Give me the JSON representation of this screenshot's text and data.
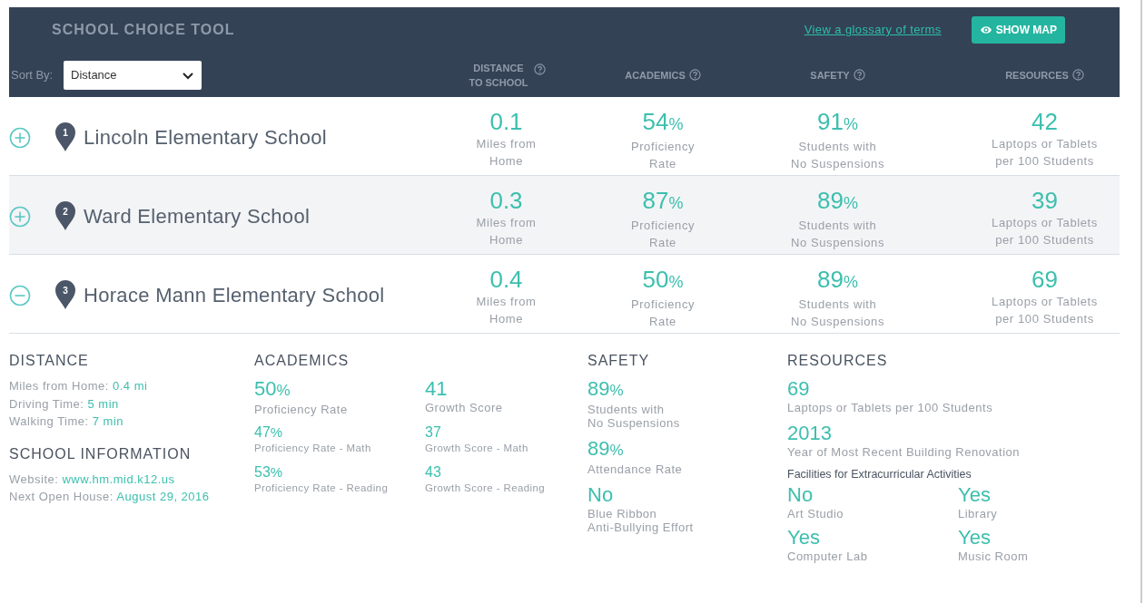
{
  "header": {
    "title": "SCHOOL CHOICE TOOL",
    "glossary_link": "View a glossary of terms",
    "show_map_button": "SHOW MAP",
    "sort": {
      "label": "Sort By:",
      "value": "Distance"
    },
    "columns": [
      {
        "label": "DISTANCE TO SCHOOL"
      },
      {
        "label": "ACADEMICS"
      },
      {
        "label": "SAFETY"
      },
      {
        "label": "RESOURCES"
      }
    ]
  },
  "schools": [
    {
      "number": "1",
      "name": "Lincoln Elementary School",
      "expanded": false,
      "highlighted": false,
      "metrics": [
        {
          "value": "0.1",
          "caption": [
            "Miles from",
            "Home"
          ]
        },
        {
          "value": "54",
          "unit": "%",
          "caption": [
            "Proficiency",
            "Rate"
          ]
        },
        {
          "value": "91",
          "unit": "%",
          "caption": [
            "Students with",
            "No Suspensions"
          ]
        },
        {
          "value": "42",
          "caption": [
            "Laptops or Tablets",
            "per 100 Students"
          ]
        }
      ]
    },
    {
      "number": "2",
      "name": "Ward Elementary School",
      "expanded": false,
      "highlighted": true,
      "metrics": [
        {
          "value": "0.3",
          "caption": [
            "Miles from",
            "Home"
          ]
        },
        {
          "value": "87",
          "unit": "%",
          "caption": [
            "Proficiency",
            "Rate"
          ]
        },
        {
          "value": "89",
          "unit": "%",
          "caption": [
            "Students with",
            "No Suspensions"
          ]
        },
        {
          "value": "39",
          "caption": [
            "Laptops or Tablets",
            "per 100 Students"
          ]
        }
      ]
    },
    {
      "number": "3",
      "name": "Horace Mann Elementary School",
      "expanded": true,
      "highlighted": false,
      "metrics": [
        {
          "value": "0.4",
          "caption": [
            "Miles from",
            "Home"
          ]
        },
        {
          "value": "50",
          "unit": "%",
          "caption": [
            "Proficiency",
            "Rate"
          ]
        },
        {
          "value": "89",
          "unit": "%",
          "caption": [
            "Students with",
            "No Suspensions"
          ]
        },
        {
          "value": "69",
          "caption": [
            "Laptops or Tablets",
            "per 100 Students"
          ]
        }
      ]
    }
  ],
  "details": {
    "distance": {
      "heading": "DISTANCE",
      "items": [
        {
          "label": "Miles from Home:",
          "value": "0.4 mi"
        },
        {
          "label": "Driving Time:",
          "value": "5 min"
        },
        {
          "label": "Walking Time:",
          "value": "7 min"
        }
      ]
    },
    "school_information": {
      "heading": "SCHOOL INFORMATION",
      "items": [
        {
          "label": "Website:",
          "value": "www.hm.mid.k12.us"
        },
        {
          "label": "Next Open House:",
          "value": "August 29, 2016"
        }
      ]
    },
    "academics": {
      "heading": "ACADEMICS",
      "metrics": [
        {
          "kind": "large",
          "value": "50",
          "unit": "%",
          "caption": [
            "Proficiency Rate"
          ]
        },
        {
          "kind": "large",
          "value": "41",
          "caption": [
            "Growth Score"
          ]
        },
        {
          "kind": "small",
          "value": "47",
          "unit": "%",
          "caption": [
            "Proficiency Rate - Math"
          ]
        },
        {
          "kind": "small",
          "value": "37",
          "caption": [
            "Growth Score - Math"
          ]
        },
        {
          "kind": "small",
          "value": "53",
          "unit": "%",
          "caption": [
            "Proficiency Rate - Reading"
          ]
        },
        {
          "kind": "small",
          "value": "43",
          "caption": [
            "Growth Score - Reading"
          ]
        }
      ]
    },
    "safety": {
      "heading": "SAFETY",
      "metrics": [
        {
          "kind": "large",
          "value": "89",
          "unit": "%",
          "caption": [
            "Students with",
            "No Suspensions"
          ]
        },
        {
          "kind": "large",
          "value": "89",
          "unit": "%",
          "caption": [
            "Attendance Rate"
          ]
        },
        {
          "kind": "large",
          "value": "No",
          "caption": [
            "Blue Ribbon",
            "Anti-Bullying Effort"
          ]
        }
      ]
    },
    "resources": {
      "heading": "RESOURCES",
      "metrics": [
        {
          "kind": "large",
          "value": "69",
          "caption": [
            "Laptops or Tablets per 100 Students"
          ]
        },
        {
          "kind": "large",
          "value": "2013",
          "caption": [
            "Year of Most Recent Building Renovation"
          ]
        }
      ],
      "facilities_heading": "Facilities for Extracurricular Activities",
      "facilities": [
        {
          "value": "No",
          "caption": "Art Studio"
        },
        {
          "value": "Yes",
          "caption": "Library"
        },
        {
          "value": "Yes",
          "caption": "Computer Lab"
        },
        {
          "value": "Yes",
          "caption": "Music Room"
        }
      ]
    }
  }
}
